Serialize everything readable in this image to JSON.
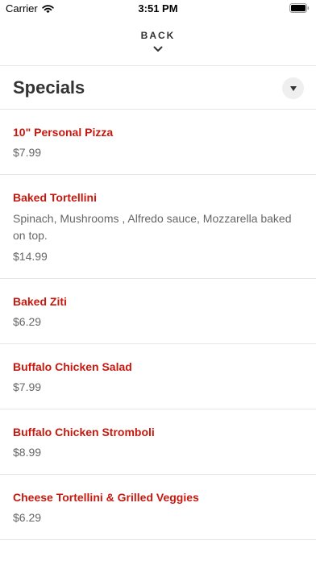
{
  "status_bar": {
    "carrier": "Carrier",
    "time": "3:51 PM"
  },
  "nav": {
    "back_label": "BACK"
  },
  "section": {
    "title": "Specials"
  },
  "items": [
    {
      "name": "10\" Personal Pizza",
      "description": "",
      "price": "$7.99"
    },
    {
      "name": "Baked Tortellini",
      "description": "Spinach, Mushrooms , Alfredo sauce, Mozzarella baked on top.",
      "price": "$14.99"
    },
    {
      "name": "Baked Ziti",
      "description": "",
      "price": "$6.29"
    },
    {
      "name": "Buffalo Chicken Salad",
      "description": "",
      "price": "$7.99"
    },
    {
      "name": "Buffalo Chicken Stromboli",
      "description": "",
      "price": "$8.99"
    },
    {
      "name": "Cheese Tortellini & Grilled Veggies",
      "description": "",
      "price": "$6.29"
    }
  ],
  "colors": {
    "item_name": "#c8180e",
    "muted_text": "#666666",
    "divider": "#e6e6e6"
  },
  "icons": {
    "wifi": "wifi-icon",
    "battery": "battery-icon",
    "back_chevron": "chevron-down-icon",
    "dropdown": "triangle-down-icon"
  }
}
